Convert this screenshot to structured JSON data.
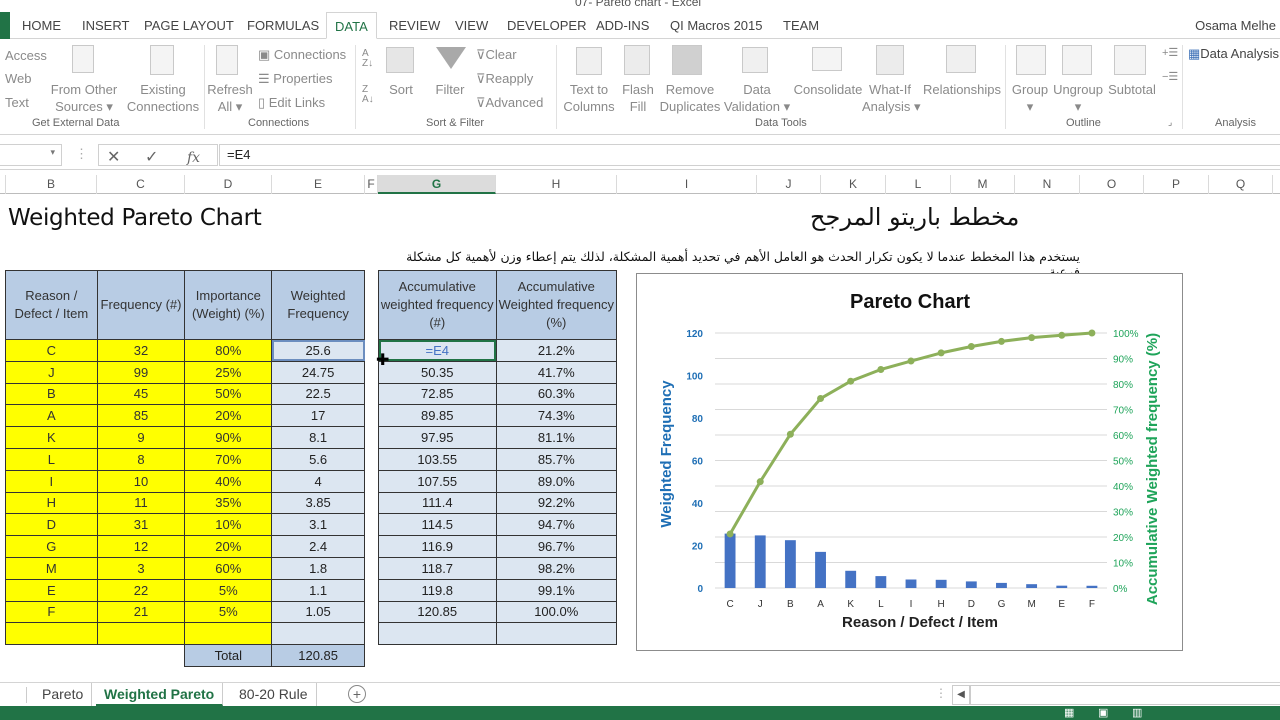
{
  "window": {
    "title": "07- Pareto chart - Excel",
    "user": "Osama Melhe"
  },
  "ribbon_tabs": [
    "HOME",
    "INSERT",
    "PAGE LAYOUT",
    "FORMULAS",
    "DATA",
    "REVIEW",
    "VIEW",
    "DEVELOPER",
    "ADD-INS",
    "QI Macros 2015",
    "TEAM"
  ],
  "active_tab": "DATA",
  "ribbon": {
    "get_external": {
      "access": "Access",
      "web": "Web",
      "text": "Text",
      "from_other_1": "From Other",
      "from_other_2": "Sources",
      "existing_1": "Existing",
      "existing_2": "Connections",
      "group": "Get External Data"
    },
    "connections": {
      "refresh_1": "Refresh",
      "refresh_2": "All",
      "connections": "Connections",
      "properties": "Properties",
      "edit_links": "Edit Links",
      "group": "Connections"
    },
    "sort_filter": {
      "sort": "Sort",
      "filter": "Filter",
      "clear": "Clear",
      "reapply": "Reapply",
      "advanced": "Advanced",
      "group": "Sort & Filter"
    },
    "data_tools": {
      "ttc_1": "Text to",
      "ttc_2": "Columns",
      "flash_1": "Flash",
      "flash_2": "Fill",
      "remove_1": "Remove",
      "remove_2": "Duplicates",
      "dv_1": "Data",
      "dv_2": "Validation",
      "consolidate": "Consolidate",
      "whatif_1": "What-If",
      "whatif_2": "Analysis",
      "relationships": "Relationships",
      "group": "Data Tools"
    },
    "outline": {
      "group_btn": "Group",
      "ungroup": "Ungroup",
      "subtotal": "Subtotal",
      "group": "Outline"
    },
    "analysis": {
      "data_analysis": "Data Analysis",
      "group": "Analysis"
    }
  },
  "formula_bar": {
    "name_box": "",
    "formula": "=E4",
    "fx": "fx"
  },
  "columns": [
    "B",
    "C",
    "D",
    "E",
    "F",
    "G",
    "H",
    "I",
    "J",
    "K",
    "L",
    "M",
    "N",
    "O",
    "P",
    "Q"
  ],
  "selected_column": "G",
  "sheet": {
    "title_en": "Weighted Pareto Chart",
    "title_ar": "مخطط باريتو المرجح",
    "description_ar": "يستخدم هذا المخطط عندما لا يكون تكرار الحدث هو العامل الأهم في تحديد أهمية المشكلة، لذلك يتم إعطاء وزن لأهمية كل مشكلة فرعية",
    "table1": {
      "headers": [
        "Reason / Defect / Item",
        "Frequency (#)",
        "Importance (Weight) (%)",
        "Weighted Frequency"
      ],
      "rows": [
        [
          "C",
          "32",
          "80%",
          "25.6"
        ],
        [
          "J",
          "99",
          "25%",
          "24.75"
        ],
        [
          "B",
          "45",
          "50%",
          "22.5"
        ],
        [
          "A",
          "85",
          "20%",
          "17"
        ],
        [
          "K",
          "9",
          "90%",
          "8.1"
        ],
        [
          "L",
          "8",
          "70%",
          "5.6"
        ],
        [
          "I",
          "10",
          "40%",
          "4"
        ],
        [
          "H",
          "11",
          "35%",
          "3.85"
        ],
        [
          "D",
          "31",
          "10%",
          "3.1"
        ],
        [
          "G",
          "12",
          "20%",
          "2.4"
        ],
        [
          "M",
          "3",
          "60%",
          "1.8"
        ],
        [
          "E",
          "22",
          "5%",
          "1.1"
        ],
        [
          "F",
          "21",
          "5%",
          "1.05"
        ],
        [
          "",
          "",
          "",
          ""
        ]
      ],
      "total_label": "Total",
      "total_value": "120.85"
    },
    "table2": {
      "headers": [
        "Accumulative weighted frequency (#)",
        "Accumulative Weighted frequency (%)"
      ],
      "rows": [
        [
          "=E4",
          "21.2%"
        ],
        [
          "50.35",
          "41.7%"
        ],
        [
          "72.85",
          "60.3%"
        ],
        [
          "89.85",
          "74.3%"
        ],
        [
          "97.95",
          "81.1%"
        ],
        [
          "103.55",
          "85.7%"
        ],
        [
          "107.55",
          "89.0%"
        ],
        [
          "111.4",
          "92.2%"
        ],
        [
          "114.5",
          "94.7%"
        ],
        [
          "116.9",
          "96.7%"
        ],
        [
          "118.7",
          "98.2%"
        ],
        [
          "119.8",
          "99.1%"
        ],
        [
          "120.85",
          "100.0%"
        ],
        [
          "",
          ""
        ]
      ]
    }
  },
  "chart_data": {
    "type": "bar",
    "title": "Pareto Chart",
    "xlabel": "Reason / Defect / Item",
    "ylabel": "Weighted Frequency",
    "y2label": "Accumulative Weighted frequency (%)",
    "categories": [
      "C",
      "J",
      "B",
      "A",
      "K",
      "L",
      "I",
      "H",
      "D",
      "G",
      "M",
      "E",
      "F"
    ],
    "ylim": [
      0,
      120
    ],
    "y_ticks": [
      0,
      20,
      40,
      60,
      80,
      100,
      120
    ],
    "y2lim": [
      0,
      100
    ],
    "y2_ticks": [
      "0%",
      "10%",
      "20%",
      "30%",
      "40%",
      "50%",
      "60%",
      "70%",
      "80%",
      "90%",
      "100%"
    ],
    "grid": true,
    "series": [
      {
        "name": "Weighted Frequency",
        "type": "bar",
        "axis": "left",
        "color": "#4472c4",
        "values": [
          25.6,
          24.75,
          22.5,
          17,
          8.1,
          5.6,
          4,
          3.85,
          3.1,
          2.4,
          1.8,
          1.1,
          1.05
        ]
      },
      {
        "name": "Accumulative Weighted frequency (%)",
        "type": "line",
        "axis": "right",
        "color": "#8db05a",
        "values": [
          21.2,
          41.7,
          60.3,
          74.3,
          81.1,
          85.7,
          89.0,
          92.2,
          94.7,
          96.7,
          98.2,
          99.1,
          100.0
        ]
      }
    ],
    "colors": {
      "left_axis": "#1f6fb5",
      "right_axis": "#1fa45a"
    }
  },
  "sheet_tabs": [
    "Pareto",
    "Weighted Pareto",
    "80-20 Rule"
  ],
  "active_sheet": "Weighted Pareto",
  "theme": {
    "accent": "#217346",
    "header_fill": "#b8cce4",
    "input_fill": "#ffff00",
    "calc_fill": "#dce6f1"
  }
}
